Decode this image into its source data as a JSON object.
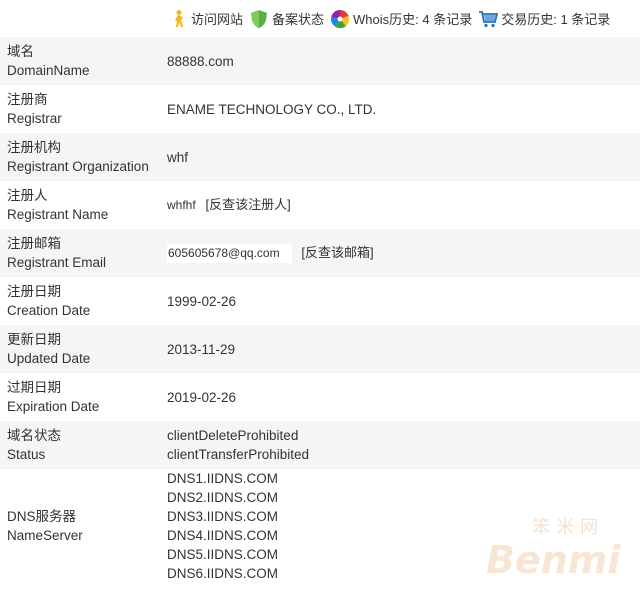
{
  "topbar": {
    "links": [
      {
        "label": "访问网站",
        "icon": "person-walking-icon"
      },
      {
        "label": "备案状态",
        "icon": "shield-icon"
      },
      {
        "label": "Whois历史: 4 条记录",
        "icon": "colorwheel-icon"
      },
      {
        "label": "交易历史: 1 条记录",
        "icon": "shopping-cart-icon"
      }
    ]
  },
  "rows": {
    "domain": {
      "cn": "域名",
      "en": "DomainName",
      "value": "88888.com"
    },
    "registrar": {
      "cn": "注册商",
      "en": "Registrar",
      "value": "ENAME TECHNOLOGY CO., LTD."
    },
    "org": {
      "cn": "注册机构",
      "en": "Registrant Organization",
      "value": "whf"
    },
    "name": {
      "cn": "注册人",
      "en": "Registrant Name",
      "value": "whfhf",
      "link": "[反查该注册人]"
    },
    "email": {
      "cn": "注册邮箱",
      "en": "Registrant Email",
      "value": "605605678@qq.com",
      "link": "[反查该邮箱]"
    },
    "created": {
      "cn": "注册日期",
      "en": "Creation Date",
      "value": "1999-02-26"
    },
    "updated": {
      "cn": "更新日期",
      "en": "Updated Date",
      "value": "2013-11-29"
    },
    "expires": {
      "cn": "过期日期",
      "en": "Expiration Date",
      "value": "2019-02-26"
    },
    "status": {
      "cn": "域名状态",
      "en": "Status",
      "values": [
        "clientDeleteProhibited",
        "clientTransferProhibited"
      ]
    },
    "ns": {
      "cn": "DNS服务器",
      "en": "NameServer",
      "values": [
        "DNS1.IIDNS.COM",
        "DNS2.IIDNS.COM",
        "DNS3.IIDNS.COM",
        "DNS4.IIDNS.COM",
        "DNS5.IIDNS.COM",
        "DNS6.IIDNS.COM"
      ]
    }
  },
  "watermark": {
    "line1": "笨米网",
    "line2": "Benmi"
  },
  "colors": {
    "row_alt": "#f5f5f5",
    "text": "#333333",
    "shield": "#58b047",
    "cart": "#2a6fb5",
    "walker": "#f3b623"
  }
}
